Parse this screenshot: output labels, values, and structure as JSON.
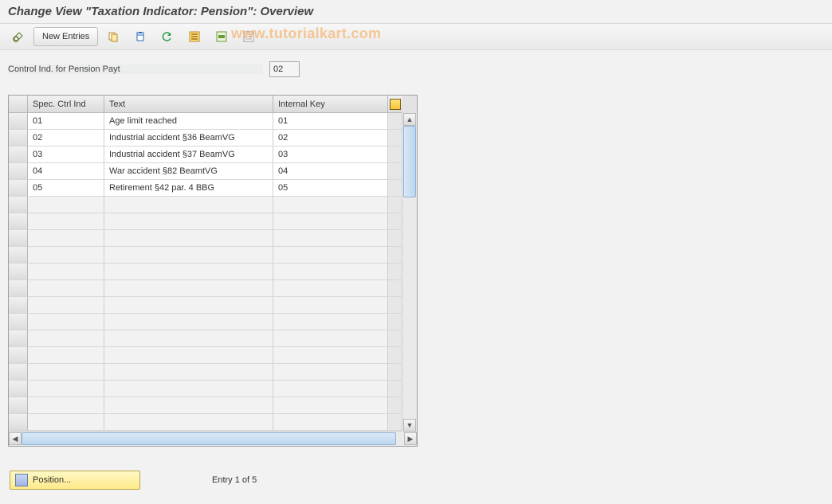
{
  "title": "Change View \"Taxation Indicator: Pension\": Overview",
  "watermark": "www.tutorialkart.com",
  "toolbar": {
    "new_entries_label": "New Entries"
  },
  "form": {
    "control_ind_label": "Control Ind. for Pension Payt",
    "control_ind_value": "02"
  },
  "table": {
    "columns": {
      "spec_ctrl_ind": "Spec. Ctrl Ind",
      "text": "Text",
      "internal_key": "Internal Key"
    },
    "rows": [
      {
        "ind": "01",
        "text": "Age limit reached",
        "key": "01",
        "selected": true
      },
      {
        "ind": "02",
        "text": "Industrial accident §36 BeamVG",
        "key": "02",
        "selected": false
      },
      {
        "ind": "03",
        "text": "Industrial accident §37 BeamVG",
        "key": "03",
        "selected": false
      },
      {
        "ind": "04",
        "text": "War accident §82 BeamtVG",
        "key": "04",
        "selected": false
      },
      {
        "ind": "05",
        "text": "Retirement §42 par. 4 BBG",
        "key": "05",
        "selected": false
      }
    ],
    "empty_rows": 14
  },
  "footer": {
    "position_label": "Position...",
    "entry_text": "Entry 1 of 5"
  }
}
